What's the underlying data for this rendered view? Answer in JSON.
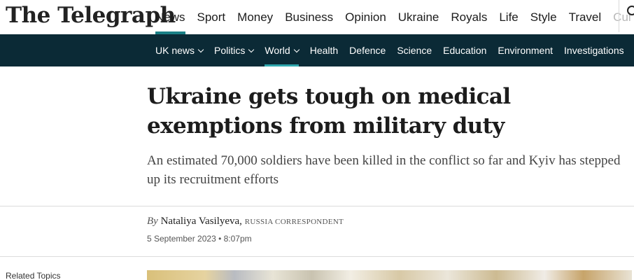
{
  "logo": {
    "text": "The Telegraph"
  },
  "primary_nav": [
    {
      "label": "News",
      "active": true
    },
    {
      "label": "Sport"
    },
    {
      "label": "Money"
    },
    {
      "label": "Business"
    },
    {
      "label": "Opinion"
    },
    {
      "label": "Ukraine"
    },
    {
      "label": "Royals"
    },
    {
      "label": "Life"
    },
    {
      "label": "Style"
    },
    {
      "label": "Travel"
    },
    {
      "label": "Cul"
    }
  ],
  "secondary_nav": [
    {
      "label": "UK news",
      "has_dropdown": true
    },
    {
      "label": "Politics",
      "has_dropdown": true
    },
    {
      "label": "World",
      "has_dropdown": true,
      "active": true
    },
    {
      "label": "Health"
    },
    {
      "label": "Defence"
    },
    {
      "label": "Science"
    },
    {
      "label": "Education"
    },
    {
      "label": "Environment"
    },
    {
      "label": "Investigations"
    }
  ],
  "article": {
    "headline": "Ukraine gets tough on medical exemptions from military duty",
    "standfirst": "An estimated 70,000 soldiers have been killed in the conflict so far and Kyiv has stepped up its recruitment efforts",
    "byline_prefix": "By",
    "author": "Nataliya Vasilyeva,",
    "author_role": "RUSSIA CORRESPONDENT",
    "date": "5 September 2023 • 8:07pm"
  },
  "sidebar": {
    "related_topics_label": "Related Topics"
  },
  "colors": {
    "nav_dark": "#0b2a36",
    "accent": "#1a8086"
  },
  "icons": {
    "search": "search-icon"
  }
}
